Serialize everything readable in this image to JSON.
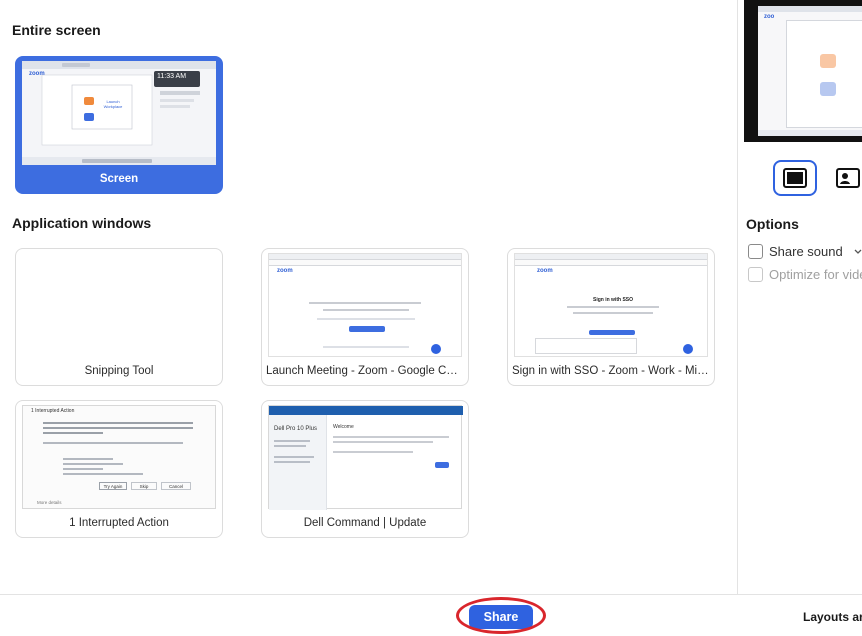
{
  "sections": {
    "entire_screen": "Entire screen",
    "application_windows": "Application windows"
  },
  "screen_tile": {
    "label": "Screen",
    "thumb_time": "11:33 AM",
    "thumb_logo": "zoom",
    "thumb_card_title": "Launch Workplace",
    "selected": true
  },
  "app_windows": [
    {
      "label": "Snipping Tool"
    },
    {
      "label": "Launch Meeting - Zoom - Google Chro...",
      "thumb_logo": "zoom",
      "thumb_button": "Launch Meeting"
    },
    {
      "label": "Sign in with SSO - Zoom - Work - Micr...",
      "thumb_logo": "zoom",
      "thumb_heading": "Sign in with SSO"
    },
    {
      "label": "1 Interrupted Action",
      "thumb_title": "1 Interrupted Action",
      "thumb_try_again": "Try Again",
      "thumb_skip": "Skip",
      "thumb_cancel": "Cancel",
      "thumb_more": "More details"
    },
    {
      "label": "Dell Command | Update",
      "thumb_product": "Dell Pro 10 Plus",
      "thumb_heading": "Welcome"
    }
  ],
  "preview": {
    "logo": "zoo"
  },
  "options": {
    "title": "Options",
    "share_sound": "Share sound",
    "optimize": "Optimize for vide"
  },
  "footer": {
    "share": "Share",
    "layouts": "Layouts ar"
  },
  "colors": {
    "accent": "#2f62e0",
    "selected_tile": "#3d6de0",
    "annotation": "#d9262c"
  }
}
